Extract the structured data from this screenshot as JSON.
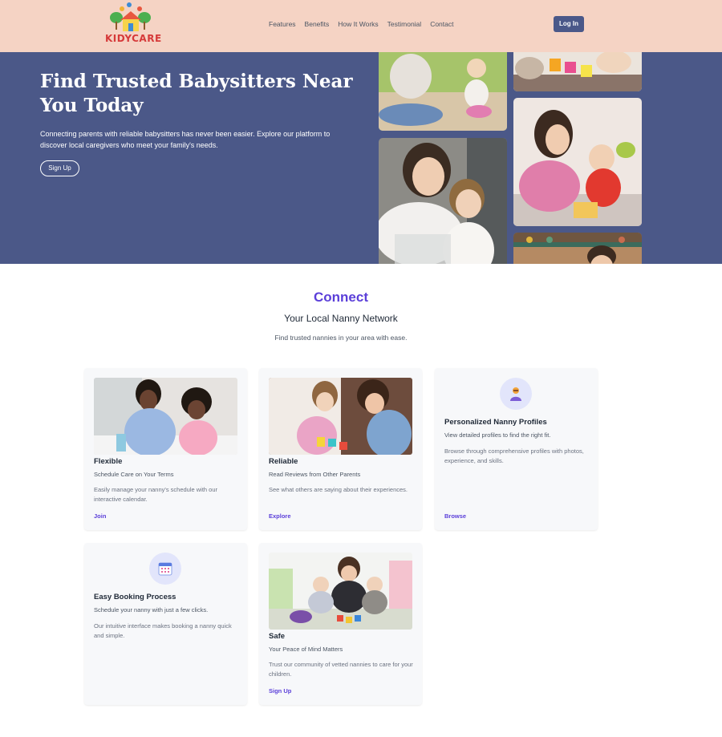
{
  "brand": {
    "name": "KIDYCARE",
    "accent": "#5b3fd9",
    "header_bg": "#f5d3c4",
    "hero_bg": "#4b5888"
  },
  "nav": {
    "items": [
      "Features",
      "Benefits",
      "How It Works",
      "Testimonial",
      "Contact"
    ],
    "login_label": "Log In"
  },
  "hero": {
    "title": "Find Trusted Babysitters Near You Today",
    "text": "Connecting parents with reliable babysitters has never been easier. Explore our platform to discover local caregivers who meet your family's needs.",
    "cta_label": "Sign Up",
    "photos": [
      "mother-and-child-outdoors",
      "toddler-stacking-cups",
      "mother-and-daughter-playing",
      "mother-and-son-drawing",
      "caregiver-in-room"
    ]
  },
  "connect": {
    "eyebrow": "Connect",
    "heading": "Your Local Nanny Network",
    "subtext": "Find trusted nannies in your area with ease."
  },
  "cards": [
    {
      "title": "Flexible",
      "subtitle": "Schedule Care on Your Terms",
      "description": "Easily manage your nanny's schedule with our interactive calendar.",
      "link": "Join",
      "image": "nanny-helping-girl-draw"
    },
    {
      "title": "Reliable",
      "subtitle": "Read Reviews from Other Parents",
      "description": "See what others are saying about their experiences.",
      "link": "Explore",
      "image": "mother-and-toddler-playing"
    },
    {
      "title": "Personalized Nanny Profiles",
      "subtitle": "View detailed profiles to find the right fit.",
      "description": "Browse through comprehensive profiles with photos, experience, and skills.",
      "link": "Browse",
      "icon": "person-icon"
    },
    {
      "title": "Easy Booking Process",
      "subtitle": "Schedule your nanny with just a few clicks.",
      "description": "Our intuitive interface makes booking a nanny quick and simple.",
      "icon": "calendar-icon"
    },
    {
      "title": "Safe",
      "subtitle": "Your Peace of Mind Matters",
      "description": "Trust our community of vetted nannies to care for your children.",
      "link": "Sign Up",
      "image": "nanny-with-kids-on-playmat"
    }
  ]
}
